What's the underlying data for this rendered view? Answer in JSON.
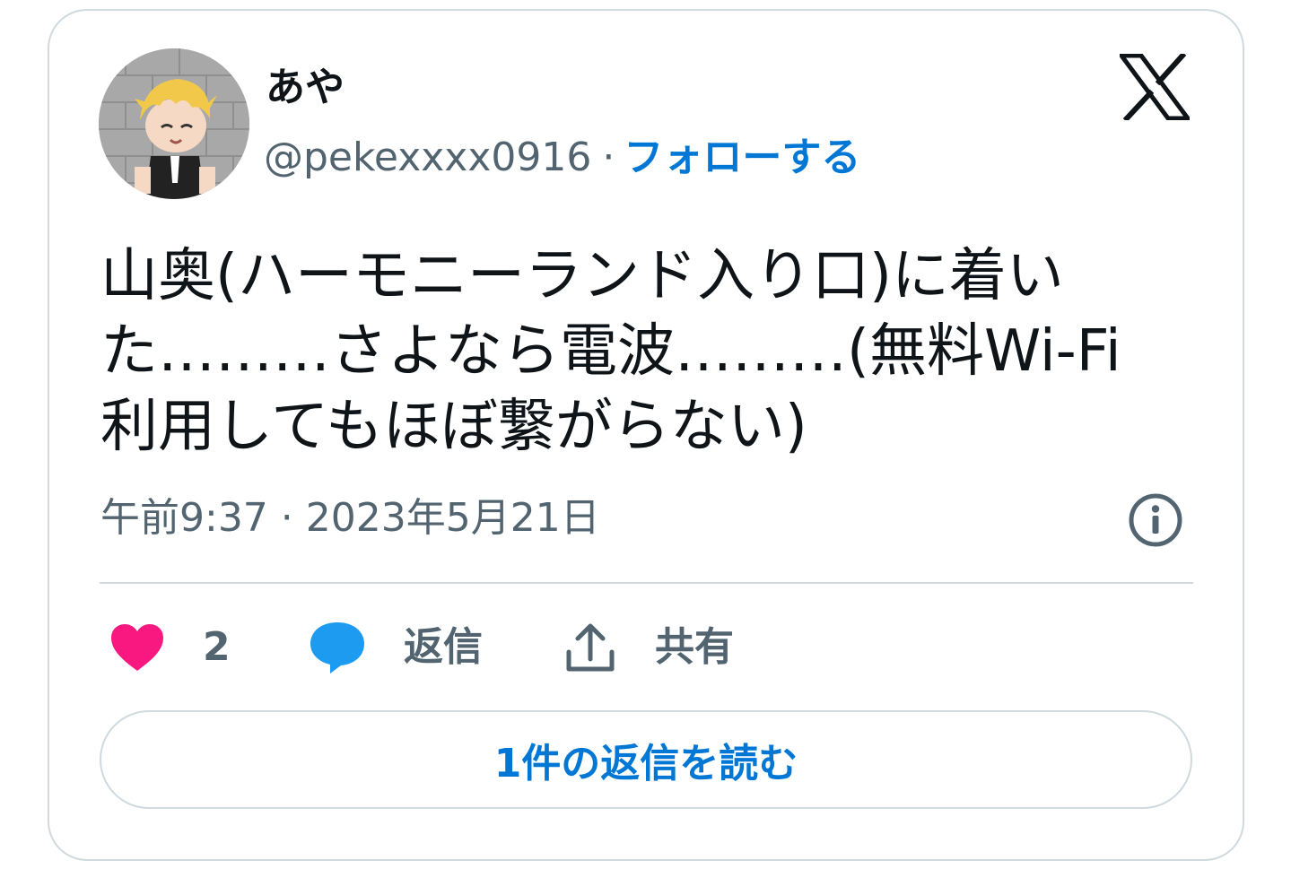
{
  "user": {
    "display_name": "あや",
    "handle": "@pekexxxx0916",
    "separator": "·",
    "follow_label": "フォローする"
  },
  "tweet": {
    "text": "山奥(ハーモニーランド入り口)に着いた………さよなら電波………(無料Wi-Fi利用してもほぼ繋がらない)",
    "timestamp": "午前9:37 · 2023年5月21日"
  },
  "actions": {
    "like_count": "2",
    "reply_label": "返信",
    "share_label": "共有"
  },
  "read_replies_label": "1件の返信を読む",
  "icons": {
    "brand": "x-logo-icon",
    "info": "info-icon",
    "like": "heart-icon",
    "reply": "speech-bubble-icon",
    "share": "share-upload-icon"
  },
  "colors": {
    "accent": "#0077d4",
    "like": "#f91880",
    "reply": "#1d9bf0",
    "muted": "#536471",
    "border": "#cfd9de"
  }
}
